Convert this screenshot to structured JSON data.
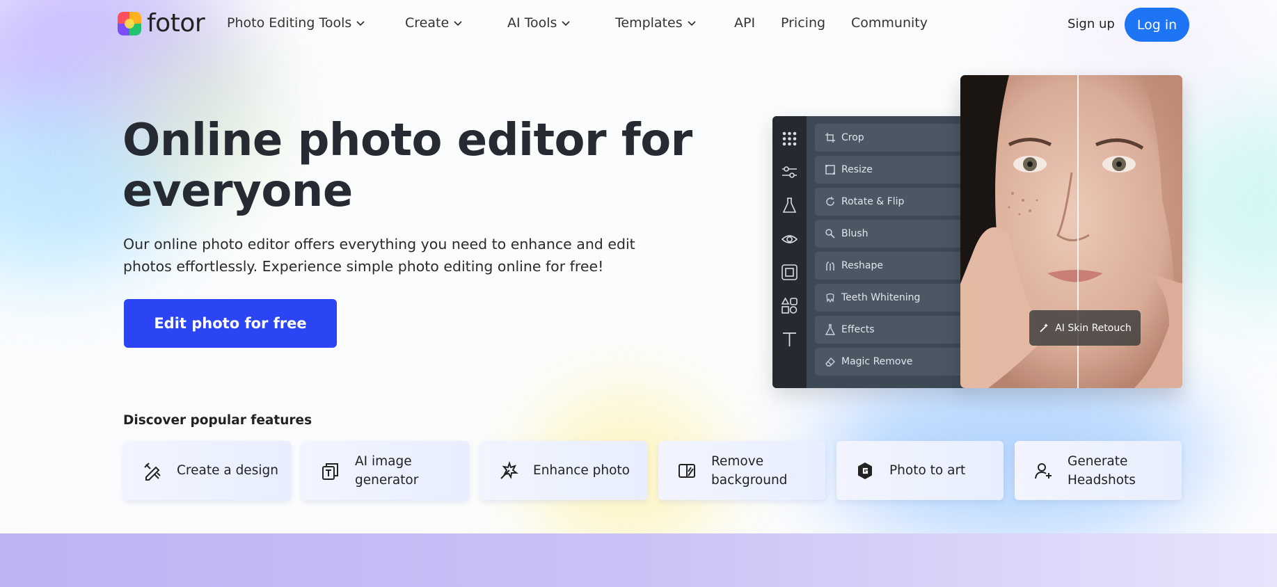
{
  "brand": {
    "name": "fotor"
  },
  "nav": {
    "items": [
      {
        "label": "Photo Editing Tools",
        "dropdown": true
      },
      {
        "label": "Create",
        "dropdown": true
      },
      {
        "label": "AI Tools",
        "dropdown": true
      },
      {
        "label": "Templates",
        "dropdown": true
      },
      {
        "label": "API",
        "dropdown": false
      },
      {
        "label": "Pricing",
        "dropdown": false
      },
      {
        "label": "Community",
        "dropdown": false
      }
    ],
    "signup": "Sign up",
    "login": "Log in"
  },
  "hero": {
    "title": "Online photo editor for everyone",
    "subtitle": "Our online photo editor offers everything you need to enhance and edit photos effortlessly. Experience simple photo editing online for free!",
    "cta": "Edit photo for free"
  },
  "editor": {
    "rail_icons": [
      "grid-icon",
      "sliders-icon",
      "flask-icon",
      "eye-icon",
      "frame-icon",
      "shapes-icon",
      "text-icon"
    ],
    "tools": [
      {
        "label": "Crop",
        "icon": "crop-icon"
      },
      {
        "label": "Resize",
        "icon": "resize-icon"
      },
      {
        "label": "Rotate & Flip",
        "icon": "rotate-icon"
      },
      {
        "label": "Blush",
        "icon": "blush-icon"
      },
      {
        "label": "Reshape",
        "icon": "reshape-icon"
      },
      {
        "label": "Teeth Whitening",
        "icon": "teeth-icon"
      },
      {
        "label": "Effects",
        "icon": "effects-icon"
      },
      {
        "label": "Magic Remove",
        "icon": "eraser-icon"
      }
    ],
    "badge": "AI Skin Retouch"
  },
  "features": {
    "title": "Discover popular features",
    "items": [
      {
        "label": "Create a design",
        "icon": "design-icon"
      },
      {
        "label": "AI image generator",
        "icon": "ai-image-icon"
      },
      {
        "label": "Enhance photo",
        "icon": "enhance-icon"
      },
      {
        "label": "Remove background",
        "icon": "remove-bg-icon"
      },
      {
        "label": "Photo to art",
        "icon": "art-icon"
      },
      {
        "label": "Generate Headshots",
        "icon": "headshot-icon"
      }
    ]
  },
  "colors": {
    "primary": "#2b45f5",
    "login": "#1d74f5",
    "editor_dark": "#3d4955"
  }
}
